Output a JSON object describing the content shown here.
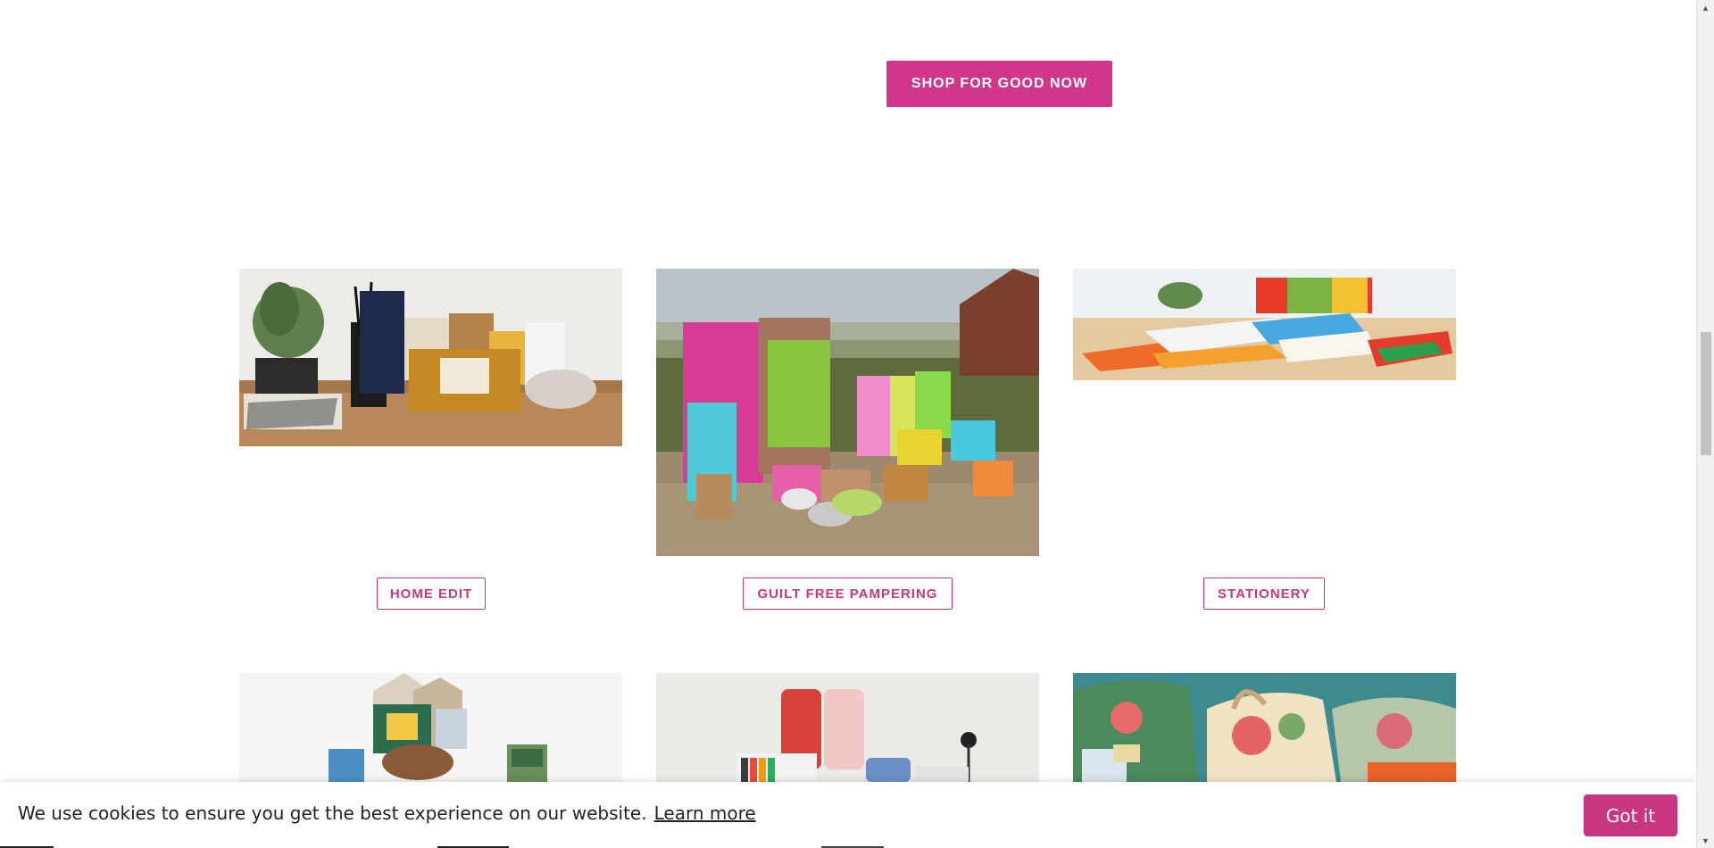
{
  "hero": {
    "cta_label": "SHOP FOR GOOD NOW"
  },
  "collections": [
    {
      "label": "HOME EDIT"
    },
    {
      "label": "GUILT FREE PAMPERING"
    },
    {
      "label": "STATIONERY"
    }
  ],
  "cookie": {
    "message": "We use cookies to ensure you get the best experience on our website.",
    "learn_more": "Learn more",
    "accept": "Got it"
  },
  "colors": {
    "brand_pink": "#d0368a",
    "button_outline": "#c8367f"
  },
  "icons": {
    "scroll_up": "triangle-up",
    "scroll_down": "triangle-down"
  }
}
